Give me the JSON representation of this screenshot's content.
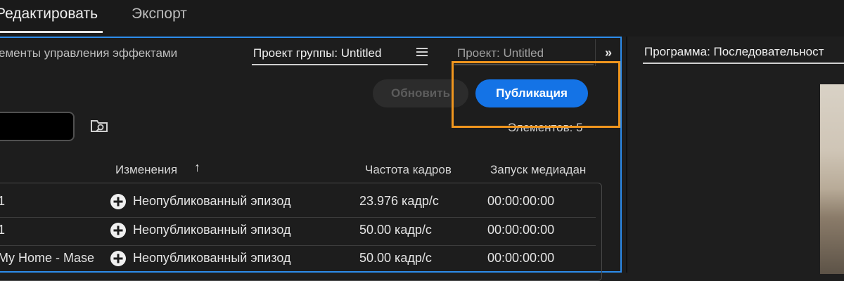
{
  "workspace_tabs": [
    {
      "label": "Редактировать",
      "active": true
    },
    {
      "label": "Экспорт",
      "active": false
    }
  ],
  "left_panel": {
    "tabs": {
      "effects": "ементы управления эффектами",
      "team_project": "Проект группы: Untitled",
      "project": "Проект: Untitled"
    },
    "overflow": "»",
    "refresh_label": "Обновить",
    "publish_label": "Публикация",
    "items_count": "Элементов: 5",
    "columns": {
      "changes": "Изменения",
      "sort_arrow": "↑",
      "frame_rate": "Частота кадров",
      "media_start": "Запуск медиадан"
    },
    "rows": [
      {
        "name": "1",
        "change": "Неопубликованный эпизод",
        "frame_rate": "23.976 кадр/с",
        "media_start": "00:00:00:00"
      },
      {
        "name": "1",
        "change": "Неопубликованный эпизод",
        "frame_rate": "50.00 кадр/с",
        "media_start": "00:00:00:00"
      },
      {
        "name": "My Home - Mase",
        "change": "Неопубликованный эпизод",
        "frame_rate": "50.00 кадр/с",
        "media_start": "00:00:00:00"
      }
    ]
  },
  "right_panel": {
    "title": "Программа: Последовательност"
  },
  "colors": {
    "accent": "#1473e6",
    "highlight": "#f0961e",
    "panel_focus": "#2d8ceb"
  }
}
